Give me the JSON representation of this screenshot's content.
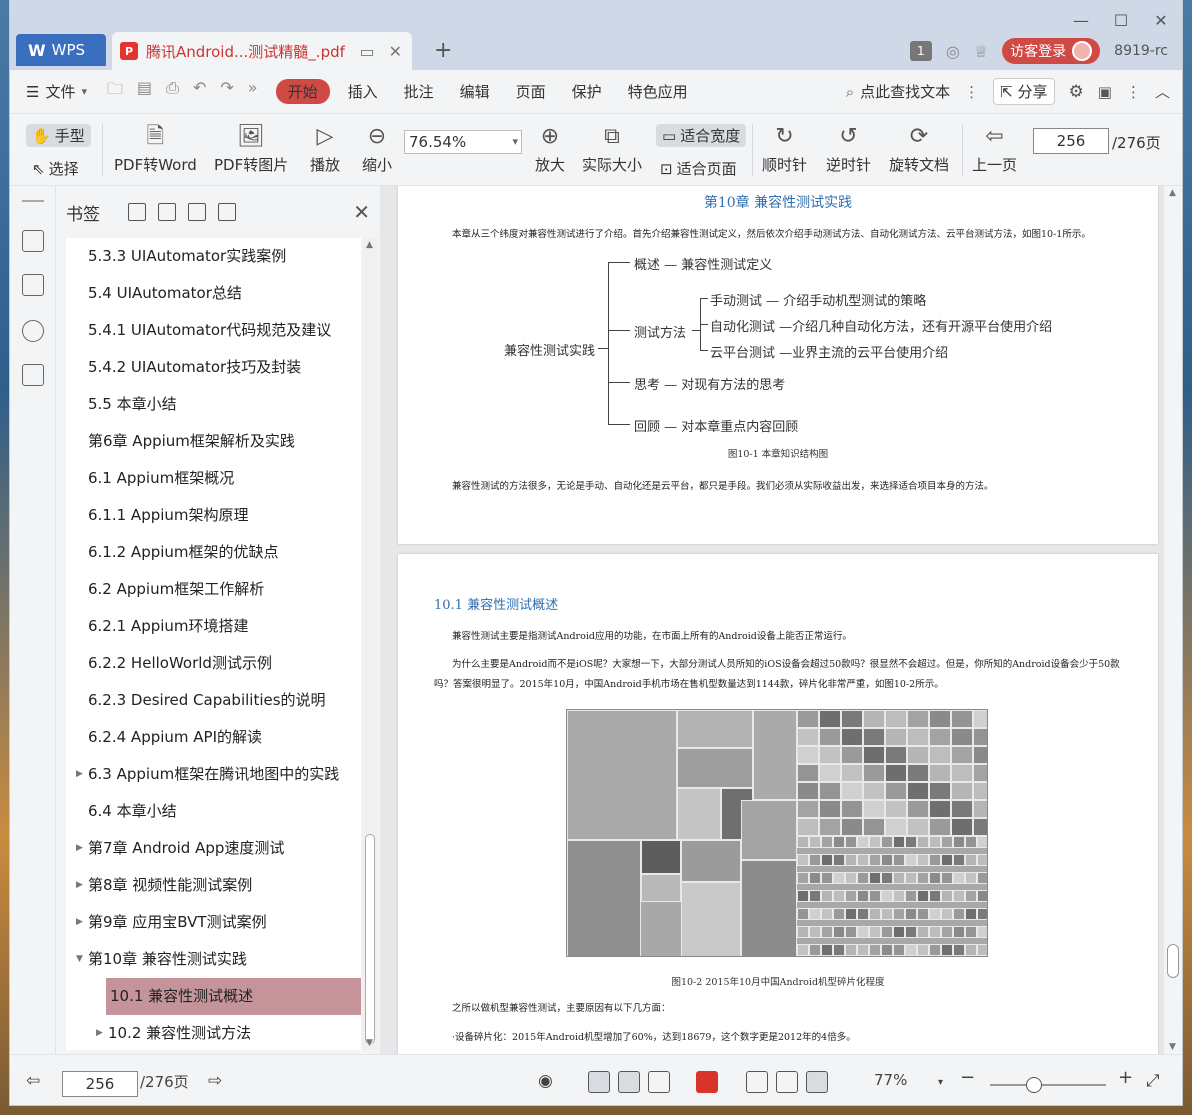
{
  "titlebar": {
    "app_tab": "WPS",
    "doc_tab": "腾讯Android...测试精髓_.pdf",
    "badge_count": "1",
    "login_label": "访客登录",
    "version": "8919-rc"
  },
  "menubar": {
    "file": "文件",
    "start": "开始",
    "items": [
      "插入",
      "批注",
      "编辑",
      "页面",
      "保护",
      "特色应用"
    ],
    "search": "点此查找文本",
    "share": "分享"
  },
  "toolbar": {
    "hand": "手型",
    "select": "选择",
    "pdf_word": "PDF转Word",
    "pdf_image": "PDF转图片",
    "play": "播放",
    "zoom_out": "缩小",
    "zoom_value": "76.54%",
    "zoom_in": "放大",
    "actual_size": "实际大小",
    "fit_width": "适合宽度",
    "fit_page": "适合页面",
    "clockwise": "顺时针",
    "counter_clockwise": "逆时针",
    "rotate_doc": "旋转文档",
    "prev_page": "上一页",
    "current_page": "256",
    "total_pages": "/276页"
  },
  "bookmarks": {
    "title": "书签",
    "items": [
      {
        "label": "5.3.3   UIAutomator实践案例",
        "indent": 1,
        "arrow": false
      },
      {
        "label": "5.4   UIAutomator总结",
        "indent": 1,
        "arrow": false
      },
      {
        "label": "5.4.1   UIAutomator代码规范及建议",
        "indent": 1,
        "arrow": false
      },
      {
        "label": "5.4.2   UIAutomator技巧及封装",
        "indent": 1,
        "arrow": false
      },
      {
        "label": "5.5   本章小结",
        "indent": 1,
        "arrow": false
      },
      {
        "label": "第6章   Appium框架解析及实践",
        "indent": 1,
        "arrow": false
      },
      {
        "label": "6.1   Appium框架概况",
        "indent": 1,
        "arrow": false
      },
      {
        "label": "6.1.1   Appium架构原理",
        "indent": 1,
        "arrow": false
      },
      {
        "label": "6.1.2   Appium框架的优缺点",
        "indent": 1,
        "arrow": false
      },
      {
        "label": "6.2   Appium框架工作解析",
        "indent": 1,
        "arrow": false
      },
      {
        "label": "6.2.1   Appium环境搭建",
        "indent": 1,
        "arrow": false
      },
      {
        "label": "6.2.2   HelloWorld测试示例",
        "indent": 1,
        "arrow": false
      },
      {
        "label": "6.2.3   Desired Capabilities的说明",
        "indent": 1,
        "arrow": false
      },
      {
        "label": "6.2.4   Appium API的解读",
        "indent": 1,
        "arrow": false
      },
      {
        "label": "6.3   Appium框架在腾讯地图中的实践",
        "indent": 1,
        "arrow": true
      },
      {
        "label": "6.4   本章小结",
        "indent": 1,
        "arrow": false
      },
      {
        "label": "第7章   Android App速度测试",
        "indent": 1,
        "arrow": true
      },
      {
        "label": "第8章   视频性能测试案例",
        "indent": 1,
        "arrow": true
      },
      {
        "label": "第9章   应用宝BVT测试案例",
        "indent": 1,
        "arrow": true
      },
      {
        "label": "第10章   兼容性测试实践",
        "indent": 1,
        "arrow": true,
        "open": true
      },
      {
        "label": "10.1   兼容性测试概述",
        "indent": 2,
        "arrow": false,
        "selected": true
      },
      {
        "label": "10.2   兼容性测试方法",
        "indent": 2,
        "arrow": true
      }
    ]
  },
  "page1": {
    "chapter_title": "第10章   兼容性测试实践",
    "intro": "本章从三个纬度对兼容性测试进行了介绍。首先介绍兼容性测试定义，然后依次介绍手动测试方法、自动化测试方法、云平台测试方法，如图10-1所示。",
    "mindmap": {
      "root": "兼容性测试实践",
      "n1": "概述 — 兼容性测试定义",
      "n2": "测试方法",
      "n2a": "手动测试 — 介绍手动机型测试的策略",
      "n2b": "自动化测试 —介绍几种自动化方法，还有开源平台使用介绍",
      "n2c": "云平台测试 —业界主流的云平台使用介绍",
      "n3": "思考 — 对现有方法的思考",
      "n4": "回顾 — 对本章重点内容回顾"
    },
    "fig_caption": "图10-1   本章知识结构图",
    "outro": "兼容性测试的方法很多，无论是手动、自动化还是云平台，都只是手段。我们必须从实际收益出发，来选择适合项目本身的方法。"
  },
  "page2": {
    "section_title": "10.1   兼容性测试概述",
    "para1": "兼容性测试主要是指测试Android应用的功能，在市面上所有的Android设备上能否正常运行。",
    "para2a": "为什么主要是Android而不是iOS呢？大家想一下，大部分测试人员所知的iOS设备会超过50款吗？很显然不会超过。但是，你所知的Android设备会少于50款",
    "para2b": "吗？答案很明显了。2015年10月，中国Android手机市场在售机型数量达到1144款，碎片化非常严重，如图10-2所示。",
    "fig_caption": "图10-2   2015年10月中国Android机型碎片化程度",
    "para3": "之所以做机型兼容性测试，主要原因有以下几方面：",
    "para4": "·设备碎片化：2015年Android机型增加了60%，达到18679，这个数字更是2012年的4倍多。"
  },
  "statusbar": {
    "current_page": "256",
    "total_pages": "/276页",
    "zoom": "77%"
  }
}
